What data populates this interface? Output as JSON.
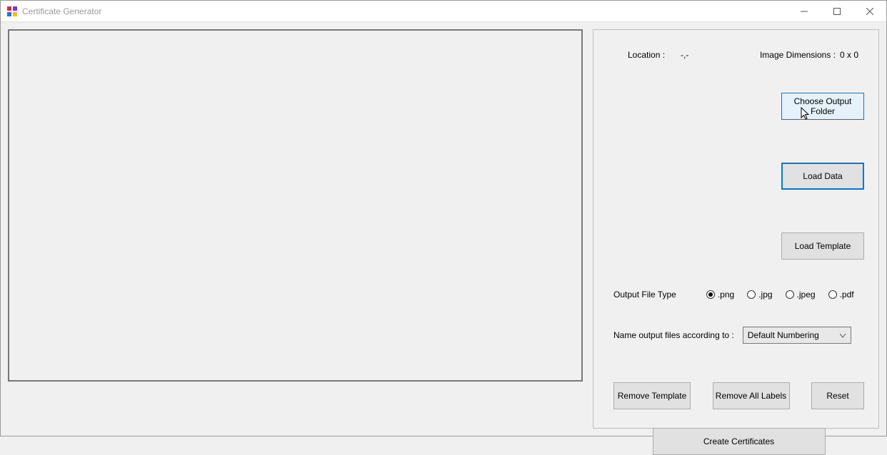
{
  "window": {
    "title": "Certificate Generator"
  },
  "info": {
    "location_label": "Location :",
    "location_value": "-,-",
    "dimensions_label": "Image Dimensions :",
    "dimensions_value": "0 x 0"
  },
  "buttons": {
    "choose_output": "Choose Output Folder",
    "load_data": "Load Data",
    "load_template": "Load Template",
    "remove_template": "Remove Template",
    "remove_all_labels": "Remove All Labels",
    "reset": "Reset",
    "create": "Create Certificates"
  },
  "file_type": {
    "label": "Output File Type",
    "options": [
      ".png",
      ".jpg",
      ".jpeg",
      ".pdf"
    ],
    "selected": ".png"
  },
  "naming": {
    "label": "Name output files according to :",
    "selected": "Default Numbering"
  },
  "fields": {
    "output_folder": "",
    "data_file": "",
    "template_file": ""
  }
}
